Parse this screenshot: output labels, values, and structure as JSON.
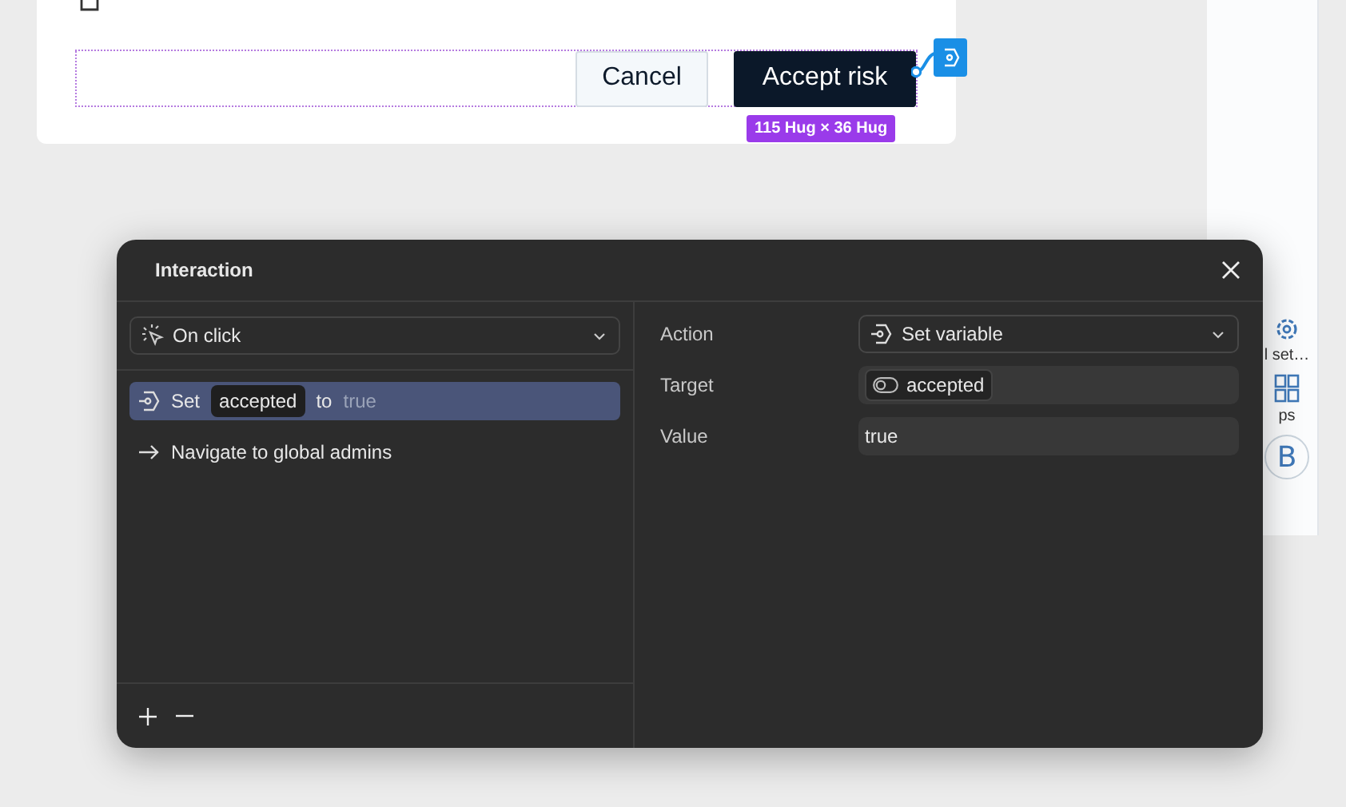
{
  "canvas": {
    "buttons": [
      {
        "label": "Cancel",
        "kind": "secondary"
      },
      {
        "label": "Accept risk",
        "kind": "primary"
      }
    ],
    "size_badge": "115 Hug × 36 Hug"
  },
  "sidebar": {
    "items": [
      {
        "label": "l set…",
        "kind": "gear"
      },
      {
        "label": "ps",
        "kind": "grid"
      }
    ],
    "avatar": "B"
  },
  "dialog": {
    "title": "Interaction",
    "trigger": "On click",
    "actions": [
      {
        "kind": "set",
        "verb": "Set",
        "variable": "accepted",
        "connector": "to",
        "value": "true",
        "selected": true
      },
      {
        "kind": "navigate",
        "text": "Navigate to global admins",
        "selected": false
      }
    ],
    "properties": [
      {
        "label": "Action",
        "kind": "select",
        "value": "Set variable"
      },
      {
        "label": "Target",
        "kind": "chip",
        "value": "accepted"
      },
      {
        "label": "Value",
        "kind": "text",
        "value": "true"
      }
    ]
  }
}
